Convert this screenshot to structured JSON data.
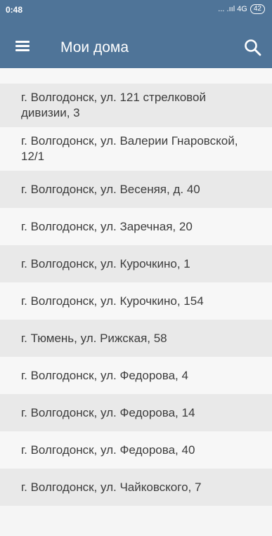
{
  "status_bar": {
    "time": "0:48",
    "signal": "... .ııl 4G",
    "battery": "42"
  },
  "app_bar": {
    "title": "Мои дома",
    "menu_icon": "hamburger-menu-icon",
    "search_icon": "search-icon",
    "color": "#4f7498"
  },
  "houses": [
    {
      "address": "г. Волгодонск, ул. 121 стрелковой дивизии, 3"
    },
    {
      "address": "г. Волгодонск, ул. Валерии Гнаровской, 12/1"
    },
    {
      "address": "г. Волгодонск, ул. Весеняя, д. 40"
    },
    {
      "address": "г. Волгодонск, ул. Заречная, 20"
    },
    {
      "address": "г. Волгодонск, ул. Курочкино, 1"
    },
    {
      "address": "г. Волгодонск, ул. Курочкино, 154"
    },
    {
      "address": "г. Тюмень, ул. Рижская, 58"
    },
    {
      "address": "г. Волгодонск, ул. Федорова, 4"
    },
    {
      "address": "г. Волгодонск, ул. Федорова, 14"
    },
    {
      "address": "г. Волгодонск, ул. Федорова, 40"
    },
    {
      "address": "г. Волгодонск, ул. Чайковского, 7"
    }
  ]
}
